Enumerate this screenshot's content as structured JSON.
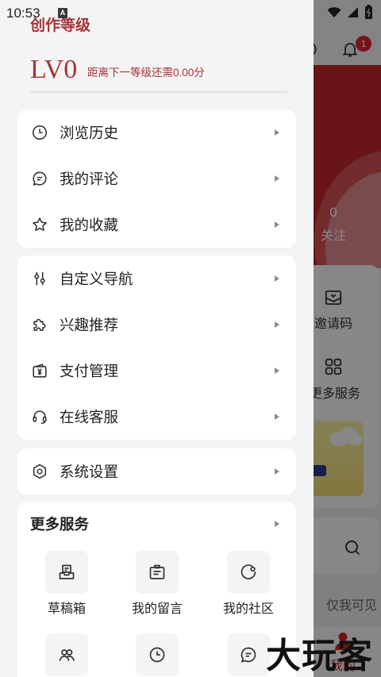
{
  "status_bar": {
    "time": "10:53",
    "notification_glyph": "A",
    "icons": [
      "wifi-icon",
      "signal-icon",
      "battery-icon"
    ]
  },
  "drawer": {
    "level_section_title": "创作等级",
    "level": "LV0",
    "level_hint": "距离下一等级还需0.00分",
    "level_progress": 0,
    "groups": [
      {
        "items": [
          {
            "label": "浏览历史",
            "icon": "clock-icon"
          },
          {
            "label": "我的评论",
            "icon": "comment-icon"
          },
          {
            "label": "我的收藏",
            "icon": "star-icon"
          }
        ]
      },
      {
        "items": [
          {
            "label": "自定义导航",
            "icon": "sliders-icon"
          },
          {
            "label": "兴趣推荐",
            "icon": "puzzle-icon"
          },
          {
            "label": "支付管理",
            "icon": "wallet-yen-icon"
          },
          {
            "label": "在线客服",
            "icon": "headset-icon"
          }
        ]
      },
      {
        "items": [
          {
            "label": "系统设置",
            "icon": "hexagon-settings-icon"
          }
        ]
      }
    ],
    "more_services": {
      "title": "更多服务",
      "items": [
        {
          "label": "草稿箱",
          "icon": "draft-box-icon"
        },
        {
          "label": "我的留言",
          "icon": "message-board-icon"
        },
        {
          "label": "我的社区",
          "icon": "community-icon"
        },
        {
          "icon": "group-icon"
        },
        {
          "icon": "clock-icon"
        },
        {
          "icon": "chat-icon"
        }
      ]
    }
  },
  "background_page": {
    "notification_count": "1",
    "follow_count": "0",
    "follow_label": "关注",
    "invite_code_label": "邀请码",
    "more_services_label": "更多服务",
    "visibility_label": "仅我可见",
    "nav_active_label": "我的"
  },
  "watermark": "大玩客",
  "colors": {
    "accent": "#a8333a",
    "badge": "#e0272f",
    "drawer_background": "#f4f4f4",
    "scrim": "rgba(0,0,0,0.47)"
  }
}
